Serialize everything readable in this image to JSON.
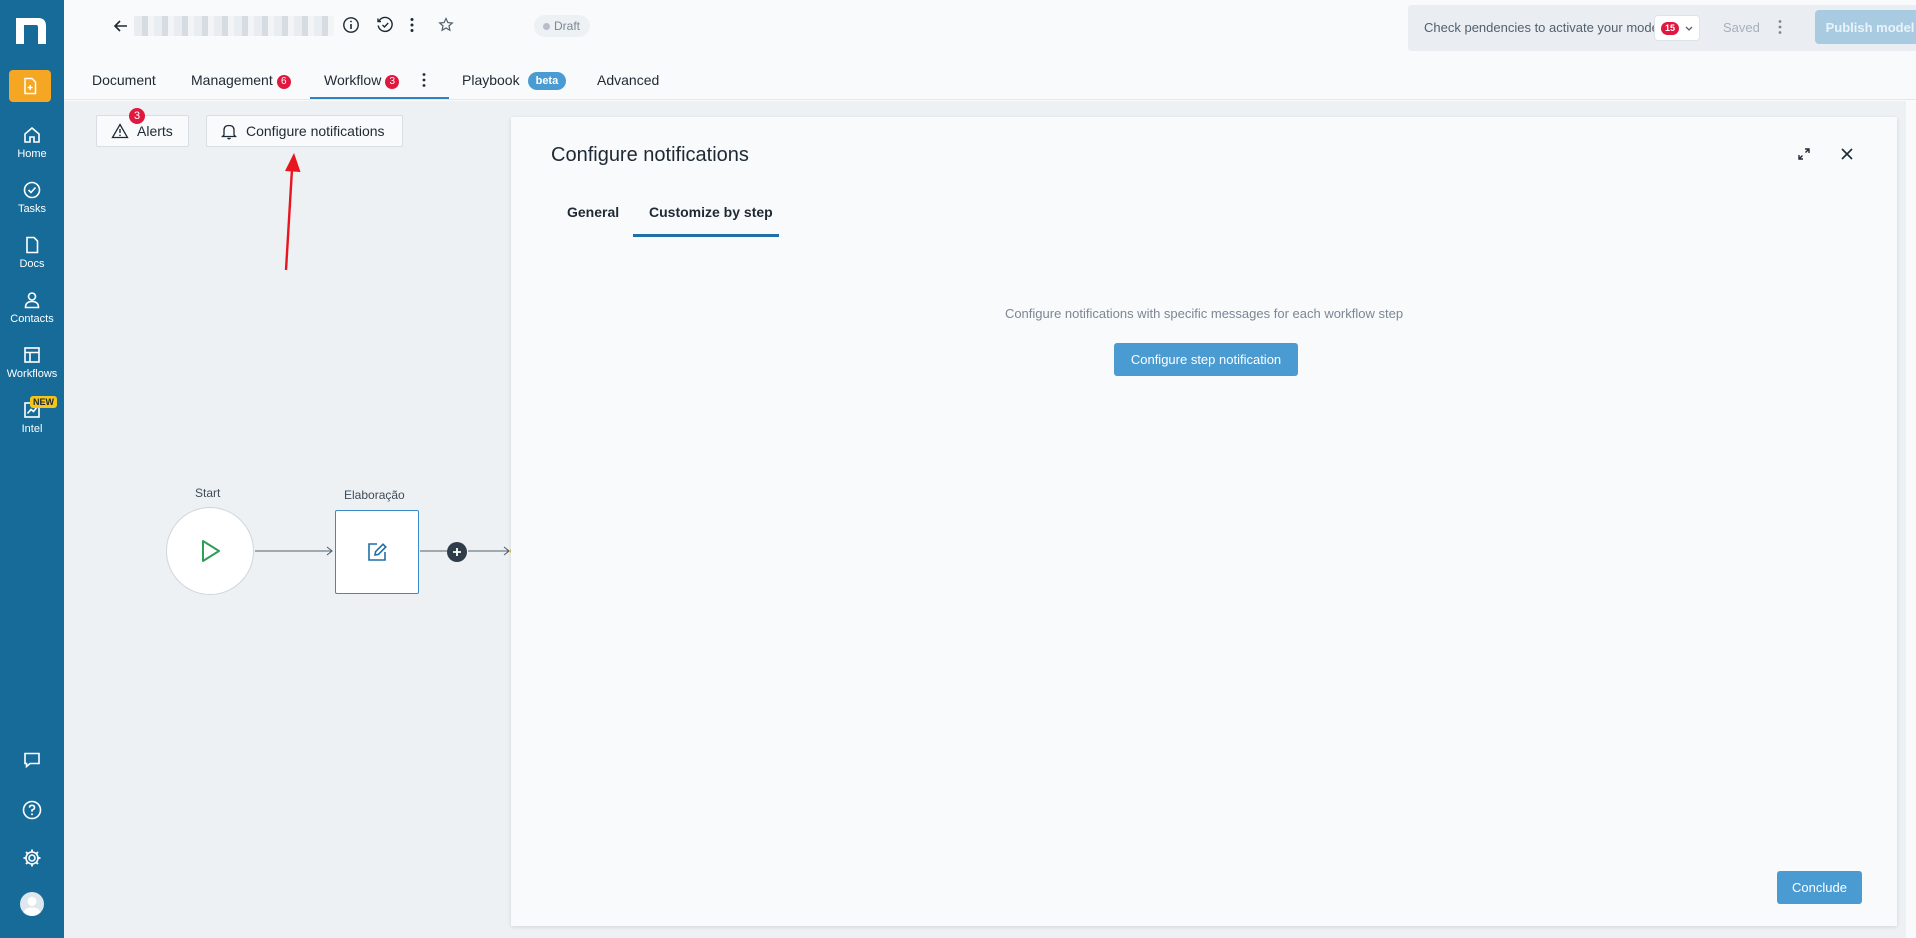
{
  "app": {
    "status": "Draft",
    "pendencies_text": "Check pendencies to activate your model",
    "pendencies_count": "15",
    "saved_label": "Saved",
    "publish_label": "Publish model"
  },
  "tabs": [
    {
      "label": "Document"
    },
    {
      "label": "Management",
      "count": "6"
    },
    {
      "label": "Workflow",
      "count": "3",
      "active": true
    },
    {
      "label": "Playbook",
      "tag": "beta"
    },
    {
      "label": "Advanced"
    }
  ],
  "sidebar": {
    "items": [
      {
        "label": "Home",
        "icon": "home-icon"
      },
      {
        "label": "Tasks",
        "icon": "check-circle-icon"
      },
      {
        "label": "Docs",
        "icon": "document-icon"
      },
      {
        "label": "Contacts",
        "icon": "person-icon"
      },
      {
        "label": "Workflows",
        "icon": "workflow-icon"
      },
      {
        "label": "Intel",
        "icon": "chart-icon",
        "badge": "NEW"
      }
    ]
  },
  "toolbar": {
    "alerts_label": "Alerts",
    "alerts_count": "3",
    "configure_label": "Configure notifications"
  },
  "workflow": {
    "start_label": "Start",
    "step_label": "Elaboração"
  },
  "panel": {
    "title": "Configure notifications",
    "tabs": [
      {
        "label": "General"
      },
      {
        "label": "Customize by step",
        "active": true
      }
    ],
    "empty_message": "Configure notifications with specific messages for each workflow step",
    "configure_step_label": "Configure step notification",
    "conclude_label": "Conclude"
  },
  "colors": {
    "sidebar": "#176b99",
    "accent": "#4a9bd2",
    "danger": "#e0183f",
    "new_doc": "#f5a623"
  }
}
